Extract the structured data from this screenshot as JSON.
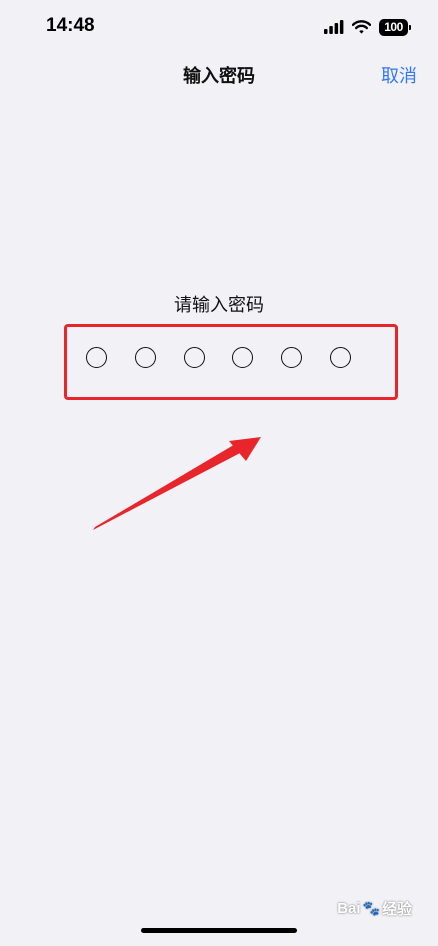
{
  "status_bar": {
    "time": "14:48",
    "battery_level": "100",
    "icons": [
      "cellular-signal-icon",
      "wifi-icon",
      "battery-icon"
    ]
  },
  "nav": {
    "title": "输入密码",
    "cancel_label": "取消"
  },
  "passcode": {
    "prompt": "请输入密码",
    "digit_count": 6,
    "entered_count": 0
  },
  "annotation": {
    "highlight_color": "#e8252a",
    "arrow_color": "#e8252a"
  },
  "watermark": {
    "text_1": "Bai",
    "text_2": "经验"
  },
  "colors": {
    "background": "#f2f1f6",
    "accent": "#3478f6"
  }
}
